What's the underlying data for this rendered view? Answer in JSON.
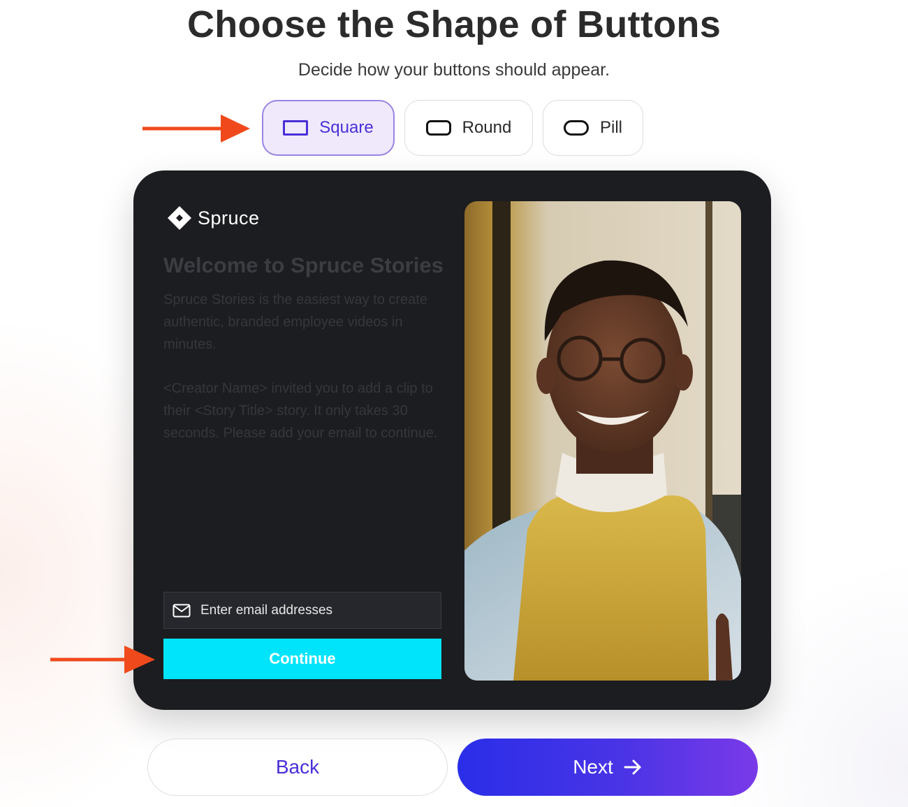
{
  "header": {
    "title": "Choose the Shape of Buttons",
    "subtitle": "Decide how your buttons should appear."
  },
  "shape_options": [
    {
      "label": "Square",
      "icon": "square-outline-icon",
      "selected": true
    },
    {
      "label": "Round",
      "icon": "rounded-rect-outline-icon",
      "selected": false
    },
    {
      "label": "Pill",
      "icon": "pill-outline-icon",
      "selected": false
    }
  ],
  "preview": {
    "brand_name": "Spruce",
    "brand_icon": "diamond-logo-icon",
    "welcome_title": "Welcome to Spruce Stories",
    "description_1": "Spruce Stories is the easiest way to create authentic, branded employee videos in minutes.",
    "description_2": "<Creator Name> invited you to add a clip to their <Story Title> story. It only takes 30 seconds. Please add your email to continue.",
    "email_placeholder": "Enter email addresses",
    "email_icon": "envelope-icon",
    "continue_label": "Continue",
    "continue_color": "#00e4fb",
    "background_color": "#1c1d20"
  },
  "footer": {
    "back_label": "Back",
    "next_label": "Next",
    "next_icon": "arrow-right-icon"
  },
  "colors": {
    "accent": "#4a2fd8",
    "selected_bg": "#efe9fb",
    "annotation_arrow": "#f04a1c"
  }
}
